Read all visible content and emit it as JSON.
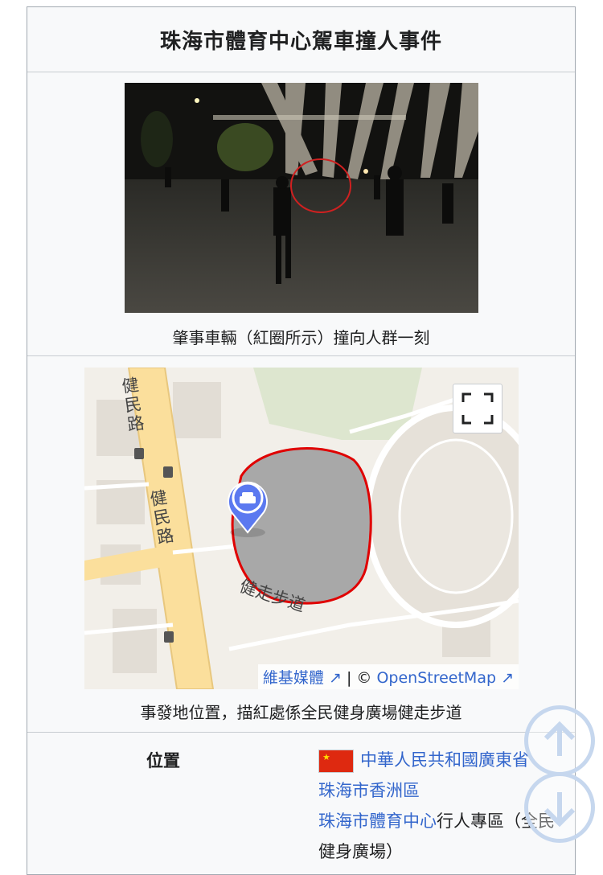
{
  "infobox": {
    "title": "珠海市體育中心駕車撞人事件",
    "photo_caption": "肇事車輛（紅圈所示）撞向人群一刻",
    "map_caption": "事發地位置，描紅處係全民健身廣場健走步道"
  },
  "map": {
    "road_label_1": "健民路",
    "road_label_2": "健民路",
    "path_label": "健走步道",
    "attribution_wiki": "維基媒體",
    "attribution_sep": "| ©",
    "attribution_osm": "OpenStreetMap",
    "highlight_color": "#e00000",
    "marker_color": "#5b79f0"
  },
  "location": {
    "label": "位置",
    "line1": "中華人民共和國廣東省",
    "line2": "珠海市香洲區",
    "line3_link": "珠海市體育中心",
    "line3_text": "行人專區（全民健身廣場）"
  }
}
